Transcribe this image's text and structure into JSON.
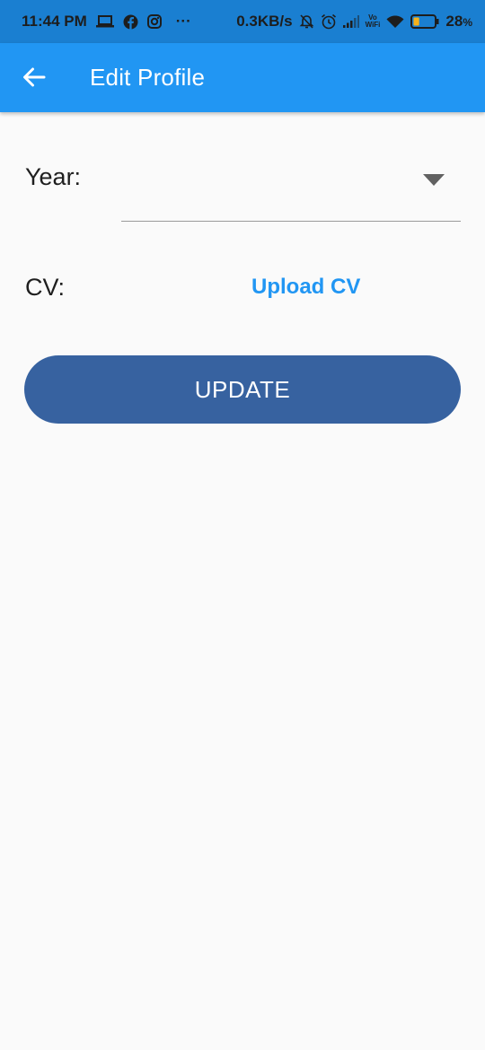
{
  "status_bar": {
    "time": "11:44 PM",
    "overflow": "···",
    "net_speed": "0.3KB/s",
    "vowifi_top": "Vo",
    "vowifi_bottom": "WiFi",
    "battery_percent": "28",
    "battery_unit": "%",
    "battery_level": 0.28,
    "icons": [
      "laptop-icon",
      "facebook-icon",
      "instagram-icon",
      "mute-bell-icon",
      "alarm-icon",
      "signal-icon",
      "wifi-icon",
      "battery-icon"
    ]
  },
  "app_bar": {
    "title": "Edit Profile",
    "back_icon": "arrow-left-icon",
    "background": "#2196f3"
  },
  "form": {
    "year_label": "Year:",
    "year_value": "",
    "cv_label": "CV:",
    "upload_label": "Upload CV",
    "link_color": "#2196f3"
  },
  "actions": {
    "update_label": "UPDATE",
    "button_color": "#3762a0"
  }
}
